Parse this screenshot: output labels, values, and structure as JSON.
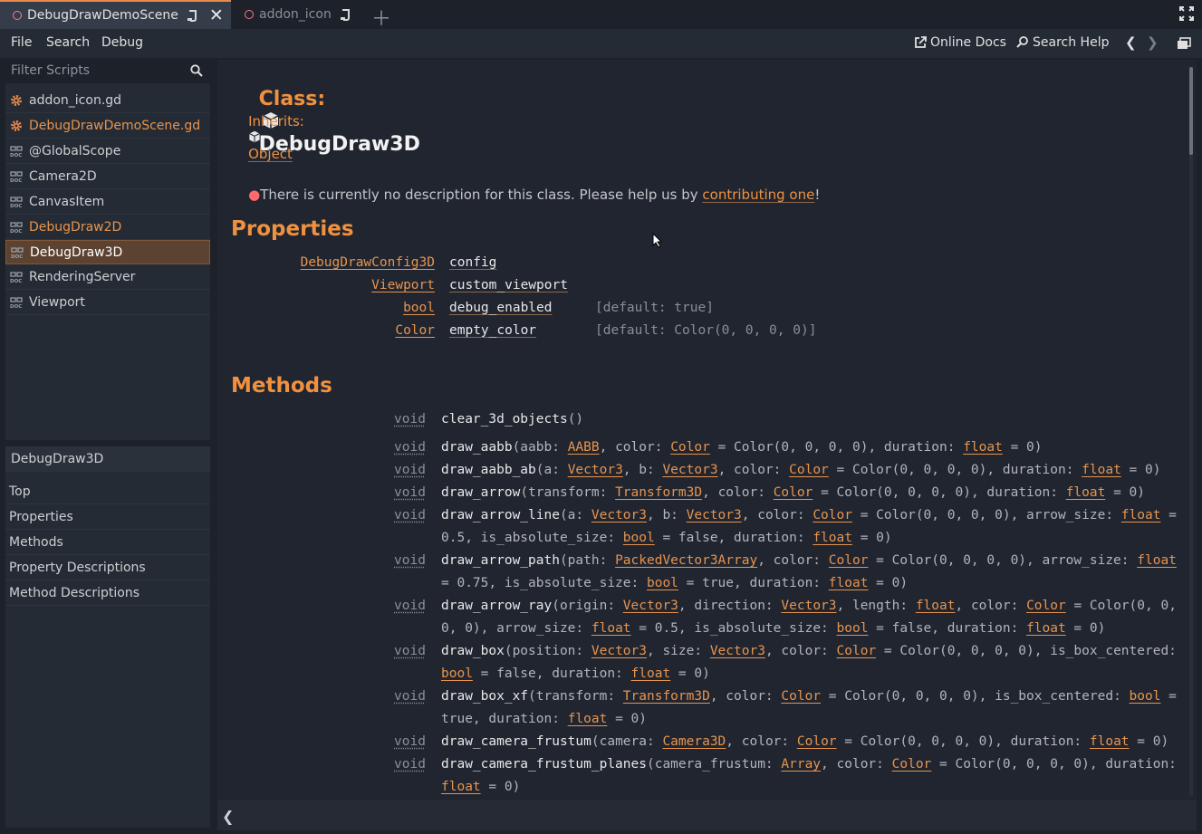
{
  "tabs": [
    {
      "label": "DebugDrawDemoScene",
      "active": true
    },
    {
      "label": "addon_icon",
      "active": false
    }
  ],
  "menu": [
    "File",
    "Search",
    "Debug"
  ],
  "toolbar": {
    "online_docs": "Online Docs",
    "search_help": "Search Help"
  },
  "filter": {
    "placeholder": "Filter Scripts"
  },
  "scripts": [
    {
      "label": "addon_icon.gd",
      "icon": "gear-icon",
      "highlight": false,
      "selected": false
    },
    {
      "label": "DebugDrawDemoScene.gd",
      "icon": "gear-icon",
      "highlight": true,
      "selected": false
    },
    {
      "label": "@GlobalScope",
      "icon": "doc-icon",
      "highlight": false,
      "selected": false
    },
    {
      "label": "Camera2D",
      "icon": "doc-icon",
      "highlight": false,
      "selected": false
    },
    {
      "label": "CanvasItem",
      "icon": "doc-icon",
      "highlight": false,
      "selected": false
    },
    {
      "label": "DebugDraw2D",
      "icon": "doc-icon",
      "highlight": true,
      "selected": false
    },
    {
      "label": "DebugDraw3D",
      "icon": "doc-icon",
      "highlight": false,
      "selected": true
    },
    {
      "label": "RenderingServer",
      "icon": "doc-icon",
      "highlight": false,
      "selected": false
    },
    {
      "label": "Viewport",
      "icon": "doc-icon",
      "highlight": false,
      "selected": false
    }
  ],
  "outline": {
    "title": "DebugDraw3D",
    "items": [
      "Top",
      "Properties",
      "Methods",
      "Property Descriptions",
      "Method Descriptions"
    ]
  },
  "doc": {
    "class_prefix": "Class:",
    "class_name": "DebugDraw3D",
    "inherits_prefix": "Inherits:",
    "inherits": "Object",
    "no_desc": "There is currently no description for this class. Please help us by ",
    "contrib_link": "contributing one",
    "no_desc_end": "!",
    "properties_heading": "Properties",
    "methods_heading": "Methods",
    "properties": [
      {
        "type": "DebugDrawConfig3D",
        "name": "config",
        "default": ""
      },
      {
        "type": "Viewport",
        "name": "custom_viewport",
        "default": ""
      },
      {
        "type": "bool",
        "name": "debug_enabled",
        "default": "[default: true]"
      },
      {
        "type": "Color",
        "name": "empty_color",
        "default": "[default: Color(0, 0, 0, 0)]"
      }
    ],
    "methods": [
      {
        "ret": "void",
        "lines": [
          [
            [
              "fn",
              "clear_3d_objects"
            ],
            [
              "p",
              "()"
            ]
          ]
        ]
      },
      {
        "ret": "void",
        "lines": [
          [
            [
              "fn",
              "draw_aabb"
            ],
            [
              "p",
              "(aabb: "
            ],
            [
              "t",
              "AABB"
            ],
            [
              "p",
              ", color: "
            ],
            [
              "t",
              "Color"
            ],
            [
              "p",
              " = Color(0, 0, 0, 0), duration: "
            ],
            [
              "t",
              "float"
            ],
            [
              "p",
              " = 0)"
            ]
          ]
        ]
      },
      {
        "ret": "void",
        "lines": [
          [
            [
              "fn",
              "draw_aabb_ab"
            ],
            [
              "p",
              "(a: "
            ],
            [
              "t",
              "Vector3"
            ],
            [
              "p",
              ", b: "
            ],
            [
              "t",
              "Vector3"
            ],
            [
              "p",
              ", color: "
            ],
            [
              "t",
              "Color"
            ],
            [
              "p",
              " = Color(0, 0, 0, 0), duration: "
            ],
            [
              "t",
              "float"
            ],
            [
              "p",
              " = 0)"
            ]
          ]
        ]
      },
      {
        "ret": "void",
        "lines": [
          [
            [
              "fn",
              "draw_arrow"
            ],
            [
              "p",
              "(transform: "
            ],
            [
              "t",
              "Transform3D"
            ],
            [
              "p",
              ", color: "
            ],
            [
              "t",
              "Color"
            ],
            [
              "p",
              " = Color(0, 0, 0, 0), duration: "
            ],
            [
              "t",
              "float"
            ],
            [
              "p",
              " = 0)"
            ]
          ]
        ]
      },
      {
        "ret": "void",
        "lines": [
          [
            [
              "fn",
              "draw_arrow_line"
            ],
            [
              "p",
              "(a: "
            ],
            [
              "t",
              "Vector3"
            ],
            [
              "p",
              ", b: "
            ],
            [
              "t",
              "Vector3"
            ],
            [
              "p",
              ", color: "
            ],
            [
              "t",
              "Color"
            ],
            [
              "p",
              " = Color(0, 0, 0, 0), arrow_size: "
            ],
            [
              "t",
              "float"
            ],
            [
              "p",
              " ="
            ]
          ],
          [
            [
              "p",
              "0.5, is_absolute_size: "
            ],
            [
              "t",
              "bool"
            ],
            [
              "p",
              " = false, duration: "
            ],
            [
              "t",
              "float"
            ],
            [
              "p",
              " = 0)"
            ]
          ]
        ]
      },
      {
        "ret": "void",
        "lines": [
          [
            [
              "fn",
              "draw_arrow_path"
            ],
            [
              "p",
              "(path: "
            ],
            [
              "t",
              "PackedVector3Array"
            ],
            [
              "p",
              ", color: "
            ],
            [
              "t",
              "Color"
            ],
            [
              "p",
              " = Color(0, 0, 0, 0), arrow_size: "
            ],
            [
              "t",
              "float"
            ]
          ],
          [
            [
              "p",
              "= 0.75, is_absolute_size: "
            ],
            [
              "t",
              "bool"
            ],
            [
              "p",
              " = true, duration: "
            ],
            [
              "t",
              "float"
            ],
            [
              "p",
              " = 0)"
            ]
          ]
        ]
      },
      {
        "ret": "void",
        "lines": [
          [
            [
              "fn",
              "draw_arrow_ray"
            ],
            [
              "p",
              "(origin: "
            ],
            [
              "t",
              "Vector3"
            ],
            [
              "p",
              ", direction: "
            ],
            [
              "t",
              "Vector3"
            ],
            [
              "p",
              ", length: "
            ],
            [
              "t",
              "float"
            ],
            [
              "p",
              ", color: "
            ],
            [
              "t",
              "Color"
            ],
            [
              "p",
              " = Color(0, 0,"
            ]
          ],
          [
            [
              "p",
              "0, 0), arrow_size: "
            ],
            [
              "t",
              "float"
            ],
            [
              "p",
              " = 0.5, is_absolute_size: "
            ],
            [
              "t",
              "bool"
            ],
            [
              "p",
              " = false, duration: "
            ],
            [
              "t",
              "float"
            ],
            [
              "p",
              " = 0)"
            ]
          ]
        ]
      },
      {
        "ret": "void",
        "lines": [
          [
            [
              "fn",
              "draw_box"
            ],
            [
              "p",
              "(position: "
            ],
            [
              "t",
              "Vector3"
            ],
            [
              "p",
              ", size: "
            ],
            [
              "t",
              "Vector3"
            ],
            [
              "p",
              ", color: "
            ],
            [
              "t",
              "Color"
            ],
            [
              "p",
              " = Color(0, 0, 0, 0), is_box_centered:"
            ]
          ],
          [
            [
              "t",
              "bool"
            ],
            [
              "p",
              " = false, duration: "
            ],
            [
              "t",
              "float"
            ],
            [
              "p",
              " = 0)"
            ]
          ]
        ]
      },
      {
        "ret": "void",
        "lines": [
          [
            [
              "fn",
              "draw_box_xf"
            ],
            [
              "p",
              "(transform: "
            ],
            [
              "t",
              "Transform3D"
            ],
            [
              "p",
              ", color: "
            ],
            [
              "t",
              "Color"
            ],
            [
              "p",
              " = Color(0, 0, 0, 0), is_box_centered: "
            ],
            [
              "t",
              "bool"
            ],
            [
              "p",
              " ="
            ]
          ],
          [
            [
              "p",
              "true, duration: "
            ],
            [
              "t",
              "float"
            ],
            [
              "p",
              " = 0)"
            ]
          ]
        ]
      },
      {
        "ret": "void",
        "lines": [
          [
            [
              "fn",
              "draw_camera_frustum"
            ],
            [
              "p",
              "(camera: "
            ],
            [
              "t",
              "Camera3D"
            ],
            [
              "p",
              ", color: "
            ],
            [
              "t",
              "Color"
            ],
            [
              "p",
              " = Color(0, 0, 0, 0), duration: "
            ],
            [
              "t",
              "float"
            ],
            [
              "p",
              " = 0)"
            ]
          ]
        ]
      },
      {
        "ret": "void",
        "lines": [
          [
            [
              "fn",
              "draw_camera_frustum_planes"
            ],
            [
              "p",
              "(camera_frustum: "
            ],
            [
              "t",
              "Array"
            ],
            [
              "p",
              ", color: "
            ],
            [
              "t",
              "Color"
            ],
            [
              "p",
              " = Color(0, 0, 0, 0), duration:"
            ]
          ],
          [
            [
              "t",
              "float"
            ],
            [
              "p",
              " = 0)"
            ]
          ]
        ]
      }
    ]
  }
}
